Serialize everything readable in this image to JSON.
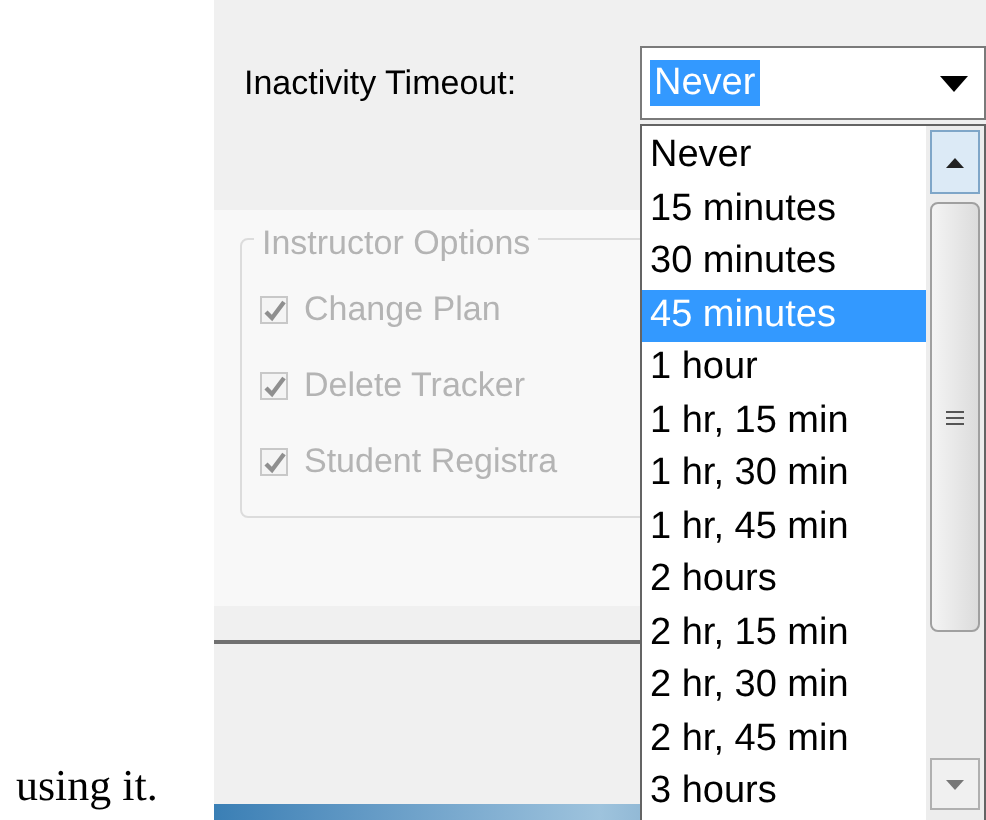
{
  "page_text": "using it.",
  "dialog": {
    "timeout_label": "Inactivity Timeout:",
    "timeout_value": "Never",
    "options": [
      {
        "label": "Never",
        "selected": false
      },
      {
        "label": "15 minutes",
        "selected": false
      },
      {
        "label": "30 minutes",
        "selected": false
      },
      {
        "label": "45 minutes",
        "selected": true
      },
      {
        "label": "1 hour",
        "selected": false
      },
      {
        "label": "1 hr, 15 min",
        "selected": false
      },
      {
        "label": "1 hr, 30 min",
        "selected": false
      },
      {
        "label": "1 hr, 45 min",
        "selected": false
      },
      {
        "label": "2 hours",
        "selected": false
      },
      {
        "label": "2 hr, 15 min",
        "selected": false
      },
      {
        "label": "2 hr, 30 min",
        "selected": false
      },
      {
        "label": "2 hr, 45 min",
        "selected": false
      },
      {
        "label": "3 hours",
        "selected": false
      }
    ],
    "group": {
      "title": "Instructor Options",
      "options": [
        {
          "label": "Change Plan",
          "checked": true,
          "disabled": true
        },
        {
          "label": "Delete Tracker",
          "checked": true,
          "disabled": true
        },
        {
          "label": "Student Registra",
          "checked": true,
          "disabled": true
        }
      ]
    }
  }
}
